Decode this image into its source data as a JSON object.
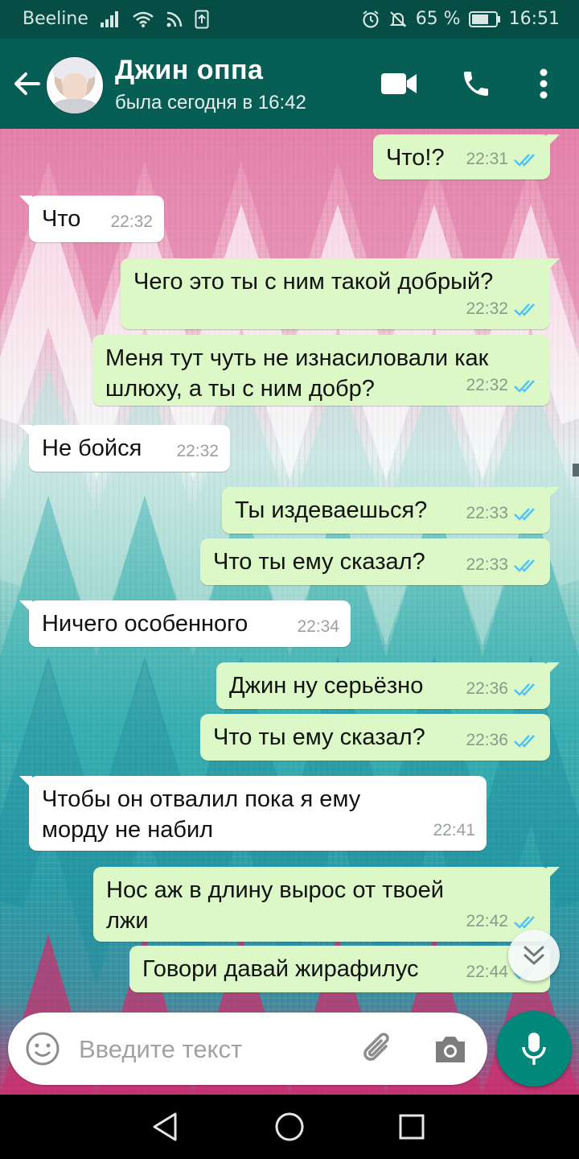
{
  "status_bar": {
    "carrier": "Beeline",
    "battery": "65 %",
    "time": "16:51"
  },
  "header": {
    "contact_name": "Джин оппа",
    "last_seen": "была сегодня в 16:42"
  },
  "messages": [
    {
      "dir": "out",
      "text": "Что!?",
      "time": "22:31"
    },
    {
      "dir": "in",
      "text": "Что",
      "time": "22:32"
    },
    {
      "dir": "out",
      "text": "Чего это ты с ним такой добрый?",
      "time": "22:32"
    },
    {
      "dir": "out",
      "text": "Меня тут чуть не изнасиловали как\nшлюху, а ты с ним добр?",
      "time": "22:32"
    },
    {
      "dir": "in",
      "text": "Не бойся",
      "time": "22:32"
    },
    {
      "dir": "out",
      "text": "Ты издеваешься?",
      "time": "22:33"
    },
    {
      "dir": "out",
      "text": "Что ты ему сказал?",
      "time": "22:33"
    },
    {
      "dir": "in",
      "text": "Ничего особенного",
      "time": "22:34"
    },
    {
      "dir": "out",
      "text": "Джин ну серьёзно",
      "time": "22:36"
    },
    {
      "dir": "out",
      "text": "Что ты ему сказал?",
      "time": "22:36"
    },
    {
      "dir": "in",
      "text": "Чтобы он отвалил пока я ему\nморду не набил",
      "time": "22:41"
    },
    {
      "dir": "out",
      "text": "Нос аж в длину вырос от твоей\nлжи",
      "time": "22:42"
    },
    {
      "dir": "out",
      "text": "Говори давай жирафилус",
      "time": "22:44"
    }
  ],
  "composer": {
    "placeholder": "Введите текст"
  },
  "colors": {
    "appbar": "#075e54",
    "statusbar": "#064d46",
    "outgoing_bubble": "#dcf8c6",
    "incoming_bubble": "#ffffff",
    "read_ticks": "#4fc3f7",
    "mic_button": "#00897b"
  },
  "icons": {
    "header": [
      "back-arrow-icon",
      "video-call-icon",
      "phone-icon",
      "more-vert-icon"
    ],
    "composer": [
      "emoji-icon",
      "attach-icon",
      "camera-icon",
      "mic-icon"
    ],
    "nav": [
      "nav-back-icon",
      "nav-home-icon",
      "nav-recents-icon"
    ]
  }
}
